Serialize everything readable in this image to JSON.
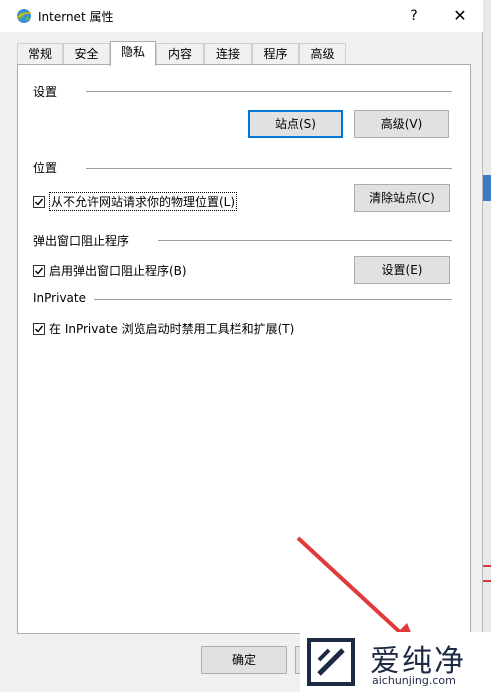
{
  "window": {
    "title": "Internet 属性",
    "help_label": "?",
    "close_label": "✕"
  },
  "tabs": [
    {
      "label": "常规"
    },
    {
      "label": "安全"
    },
    {
      "label": "隐私",
      "active": true
    },
    {
      "label": "内容"
    },
    {
      "label": "连接"
    },
    {
      "label": "程序"
    },
    {
      "label": "高级"
    }
  ],
  "settings": {
    "heading": "设置",
    "sites_button": "站点(S)",
    "advanced_button": "高级(V)"
  },
  "location": {
    "heading": "位置",
    "checkbox_label": "从不允许网站请求你的物理位置(L)",
    "checked": true,
    "clear_sites_button": "清除站点(C)"
  },
  "popup_blocker": {
    "heading": "弹出窗口阻止程序",
    "checkbox_label": "启用弹出窗口阻止程序(B)",
    "checked": true,
    "settings_button": "设置(E)"
  },
  "inprivate": {
    "heading": "InPrivate",
    "checkbox_label": "在 InPrivate 浏览启动时禁用工具栏和扩展(T)",
    "checked": true
  },
  "footer": {
    "ok_button": "确定"
  },
  "watermark": {
    "brand": "爱纯净",
    "url": "aichunjing.com"
  },
  "colors": {
    "focus_border": "#0078d7",
    "arrow": "#e03a3a"
  }
}
